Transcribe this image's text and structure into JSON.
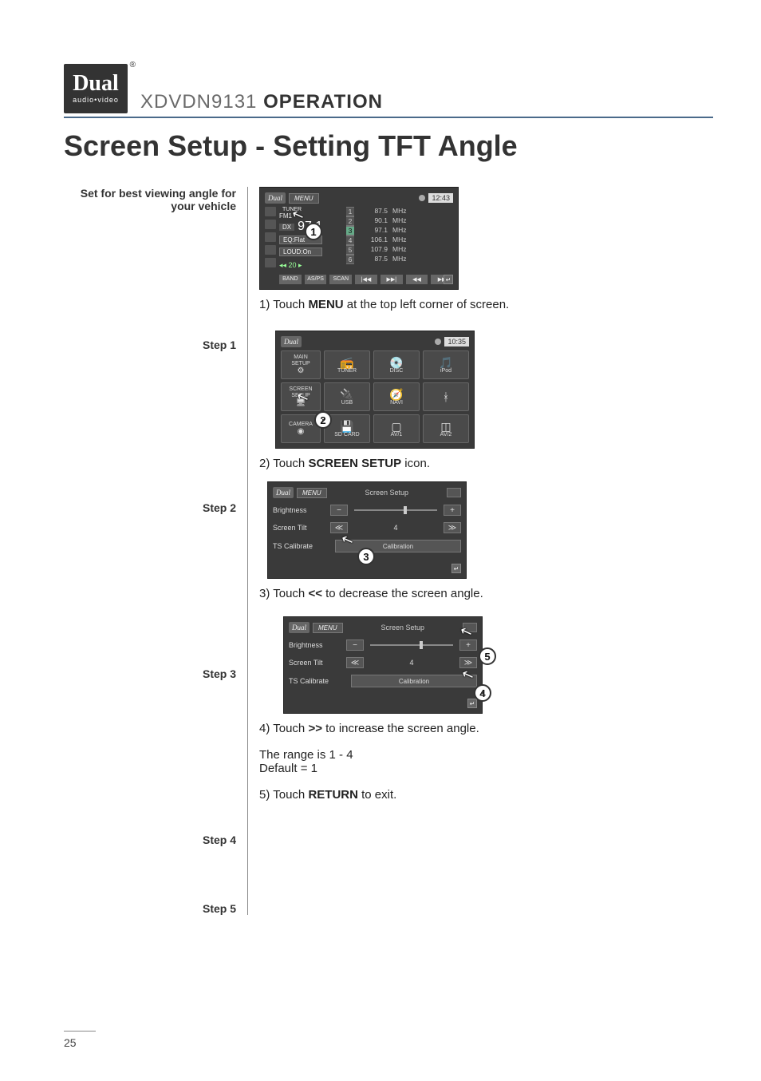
{
  "header": {
    "logo_text": "Dual",
    "logo_sub": "audio•video",
    "model": "XDVDN9131",
    "section_word": "OPERATION"
  },
  "title": "Screen Setup - Setting TFT Angle",
  "intro_label": "Set for best viewing angle for your vehicle",
  "tuner_shot": {
    "menu": "MENU",
    "clock": "12:43",
    "band_label": "TUNER",
    "band": "FM1",
    "dx": "DX",
    "freq": "97.1",
    "eq": "EQ:Flat",
    "loud": "LOUD:On",
    "vol_disp": "◂◂ 20 ▸",
    "presets": [
      {
        "n": "1",
        "f": "87.5",
        "u": "MHz"
      },
      {
        "n": "2",
        "f": "90.1",
        "u": "MHz"
      },
      {
        "n": "3",
        "f": "97.1",
        "u": "MHz"
      },
      {
        "n": "4",
        "f": "106.1",
        "u": "MHz"
      },
      {
        "n": "5",
        "f": "107.9",
        "u": "MHz"
      },
      {
        "n": "6",
        "f": "87.5",
        "u": "MHz"
      }
    ],
    "bottom_buttons": [
      "BAND",
      "AS/PS",
      "SCAN",
      "|◀◀",
      "▶▶|",
      "◀◀",
      "▶▶"
    ],
    "callout": "1"
  },
  "step1": {
    "label": "Step 1",
    "text_pre": "1) Touch ",
    "text_bold": "MENU",
    "text_post": " at the top left corner of screen."
  },
  "menu_shot": {
    "clock": "10:35",
    "side_items": [
      {
        "l1": "MAIN",
        "l2": "SETUP"
      },
      {
        "l1": "SCREEN",
        "l2": "SETUP"
      },
      {
        "l1": "CAMERA",
        "l2": ""
      }
    ],
    "grid": [
      {
        "label": "TUNER",
        "ico": "📻"
      },
      {
        "label": "DISC",
        "ico": "💿"
      },
      {
        "label": "iPod",
        "ico": "🎵"
      },
      {
        "label": "USB",
        "ico": "🔌"
      },
      {
        "label": "NAVI",
        "ico": "🧭"
      },
      {
        "label": "",
        "ico": "ᚼ"
      },
      {
        "label": "SD CARD",
        "ico": "💾"
      },
      {
        "label": "AV/1",
        "ico": "▢"
      },
      {
        "label": "AV/2",
        "ico": "◫"
      }
    ],
    "callout": "2"
  },
  "step2": {
    "label": "Step 2",
    "text_pre": "2) Touch ",
    "text_bold": "SCREEN SETUP",
    "text_post": " icon."
  },
  "screen_setup_shot": {
    "menu": "MENU",
    "title": "Screen Setup",
    "rows": {
      "brightness": "Brightness",
      "tilt": "Screen Tilt",
      "tilt_value": "4",
      "calibrate": "TS Calibrate",
      "calib_btn": "Calibration"
    },
    "dec": "≪",
    "inc": "≫",
    "callout3": "3",
    "callout4": "4",
    "callout5": "5"
  },
  "step3": {
    "label": "Step 3",
    "text_pre": "3) Touch ",
    "text_bold": "<<",
    "text_post": " to decrease the screen angle."
  },
  "step4": {
    "label": "Step 4",
    "text_pre": "4) Touch ",
    "text_bold": ">>",
    "text_post": " to increase the screen angle.",
    "range": "The range is 1 - 4",
    "default": "Default = 1"
  },
  "step5": {
    "label": "Step 5",
    "text_pre": "5) Touch ",
    "text_bold": "RETURN",
    "text_post": " to exit."
  },
  "page_number": "25"
}
